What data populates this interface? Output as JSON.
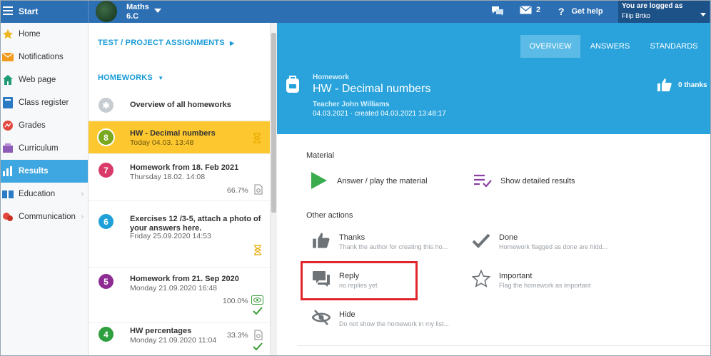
{
  "topbar": {
    "start_label": "Start",
    "class_name": "Maths",
    "class_group": "6.C",
    "messages_count": "2",
    "help_label": "Get help",
    "logged_label": "You are logged as",
    "user_name": "Filip Brtko"
  },
  "sidebar": {
    "items": [
      {
        "label": "Home",
        "icon": "star-icon"
      },
      {
        "label": "Notifications",
        "icon": "envelope-icon"
      },
      {
        "label": "Web page",
        "icon": "house-icon"
      },
      {
        "label": "Class register",
        "icon": "book-icon"
      },
      {
        "label": "Grades",
        "icon": "grades-icon"
      },
      {
        "label": "Curriculum",
        "icon": "curriculum-icon"
      },
      {
        "label": "Results",
        "icon": "bar-chart-icon"
      },
      {
        "label": "Education",
        "icon": "education-icon"
      },
      {
        "label": "Communication",
        "icon": "chat-icon"
      }
    ]
  },
  "list": {
    "projects_heading": "TEST / PROJECT ASSIGNMENTS",
    "homeworks_heading": "HOMEWORKS",
    "overview_label": "Overview of all homeworks",
    "items": [
      {
        "num": "8",
        "title": "HW - Decimal numbers",
        "date": "Today 04.03. 13:48",
        "pct": ""
      },
      {
        "num": "7",
        "title": "Homework from 18. Feb 2021",
        "date": "Thursday 18.02. 14:08",
        "pct": "66.7%"
      },
      {
        "num": "6",
        "title": "Exercises 12 /3-5, attach a photo of your answers here.",
        "date": "Friday 25.09.2020 14:53",
        "pct": ""
      },
      {
        "num": "5",
        "title": "Homework from 21. Sep 2020",
        "date": "Monday 21.09.2020 16:48",
        "pct": "100.0%"
      },
      {
        "num": "4",
        "title": "HW percentages",
        "date": "Monday 21.09.2020 11:04",
        "pct": "33.3%"
      }
    ]
  },
  "main": {
    "tabs": [
      "OVERVIEW",
      "ANSWERS",
      "STANDARDS"
    ],
    "kind": "Homework",
    "title": "HW - Decimal numbers",
    "teacher": "Teacher John Williams",
    "created": "04.03.2021 · created 04.03.2021 13:48:17",
    "thanks_label": "0 thanks",
    "material_label": "Material",
    "answer_label": "Answer / play the material",
    "results_label": "Show detailed results",
    "other_label": "Other actions",
    "actions": {
      "thanks": {
        "title": "Thanks",
        "sub": "Thank the author for creating this ho..."
      },
      "done": {
        "title": "Done",
        "sub": "Homework flagged as done are hidd..."
      },
      "reply": {
        "title": "Reply",
        "sub": "no replies yet"
      },
      "important": {
        "title": "Important",
        "sub": "Flag the homework as important"
      },
      "hide": {
        "title": "Hide",
        "sub": "Do not show the homework in my list..."
      }
    }
  },
  "colors": {
    "topbar": "#2d6fb3",
    "header": "#2aa3dc",
    "accent_selected": "#fdc82f",
    "highlight": "#e0262b",
    "badge_8": "#7aa81e",
    "badge_7": "#d93a6a",
    "badge_6": "#1fa0d8",
    "badge_5": "#8e2c93",
    "badge_4": "#2e9f3e"
  }
}
